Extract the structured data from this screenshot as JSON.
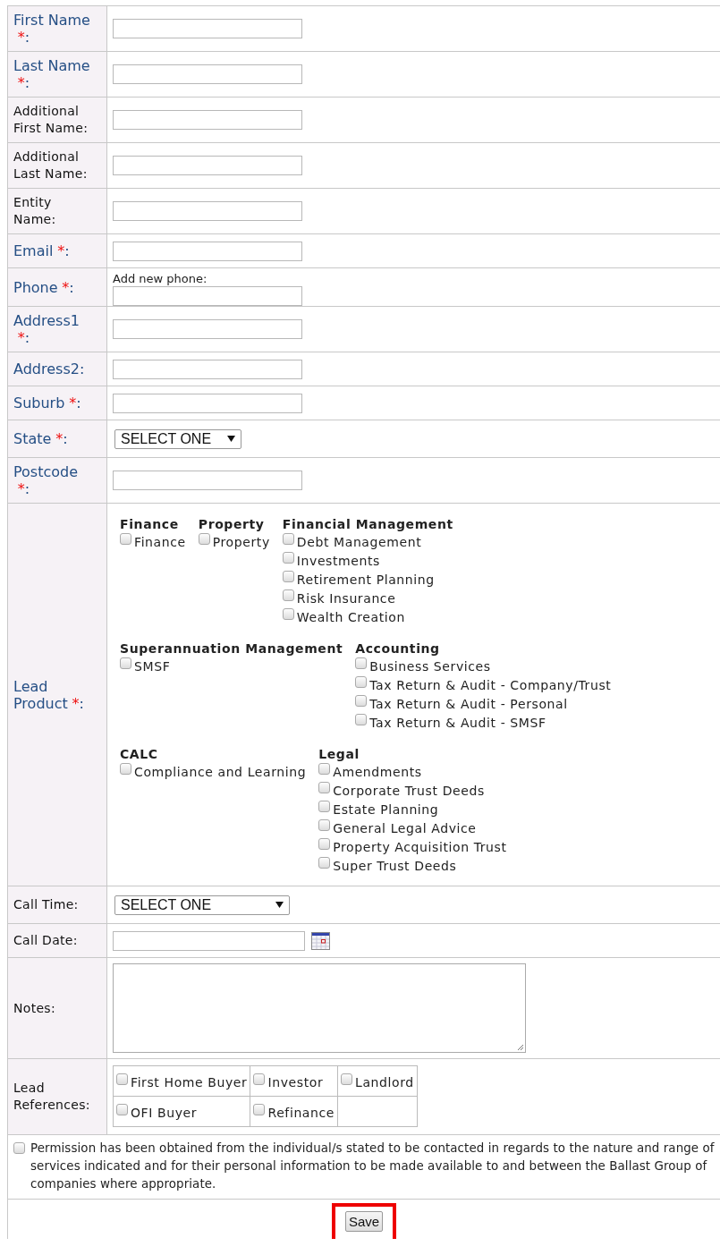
{
  "fields": [
    {
      "kind": "text",
      "label": "First Name",
      "accent": true,
      "required_mark": "*",
      "suffix": ":"
    },
    {
      "kind": "text",
      "label": "Last Name",
      "accent": true,
      "required_mark": "*",
      "suffix": ":"
    },
    {
      "kind": "text",
      "label": "Additional First Name",
      "accent": false,
      "suffix": ":"
    },
    {
      "kind": "text",
      "label": "Additional Last Name",
      "accent": false,
      "suffix": ":"
    },
    {
      "kind": "text",
      "label": "Entity Name",
      "accent": false,
      "suffix": ":"
    },
    {
      "kind": "text",
      "label": "Email",
      "accent": true,
      "required_mark": "*",
      "suffix": ":"
    },
    {
      "kind": "phone",
      "label": "Phone",
      "accent": true,
      "required_mark": "*",
      "suffix": ":",
      "hint": "Add new phone:"
    },
    {
      "kind": "text",
      "label": "Address1",
      "accent": true,
      "required_mark": "*",
      "suffix": ":"
    },
    {
      "kind": "text",
      "label": "Address2",
      "accent": true,
      "suffix": ":"
    },
    {
      "kind": "text",
      "label": "Suburb",
      "accent": true,
      "required_mark": "*",
      "suffix": ":"
    },
    {
      "kind": "select",
      "label": "State",
      "accent": true,
      "required_mark": "*",
      "suffix": ":",
      "value": "SELECT ONE"
    },
    {
      "kind": "text",
      "label": "Postcode",
      "accent": true,
      "required_mark": "*",
      "suffix": ":"
    },
    {
      "kind": "products",
      "label": "Lead Product",
      "accent": true,
      "required_mark": "*",
      "suffix": ":",
      "rows": [
        {
          "groups": [
            {
              "title": "Finance",
              "options": [
                {
                  "label": "Finance",
                  "checked": false
                }
              ]
            },
            {
              "title": "Property",
              "options": [
                {
                  "label": "Property",
                  "checked": false
                }
              ]
            },
            {
              "title": "Financial Management",
              "options": [
                {
                  "label": "Debt Management",
                  "checked": false
                },
                {
                  "label": "Investments",
                  "checked": false
                },
                {
                  "label": "Retirement Planning",
                  "checked": false
                },
                {
                  "label": "Risk Insurance",
                  "checked": false
                },
                {
                  "label": "Wealth Creation",
                  "checked": false
                }
              ]
            }
          ]
        },
        {
          "groups": [
            {
              "title": "Superannuation Management",
              "options": [
                {
                  "label": "SMSF",
                  "checked": false
                }
              ]
            },
            {
              "title": "Accounting",
              "options": [
                {
                  "label": "Business Services",
                  "checked": false
                },
                {
                  "label": "Tax Return & Audit - Company/Trust",
                  "checked": false
                },
                {
                  "label": "Tax Return & Audit - Personal",
                  "checked": false
                },
                {
                  "label": "Tax Return & Audit - SMSF",
                  "checked": false
                }
              ]
            }
          ]
        },
        {
          "groups": [
            {
              "title": "CALC",
              "options": [
                {
                  "label": "Compliance and Learning",
                  "checked": false
                }
              ]
            },
            {
              "title": "Legal",
              "options": [
                {
                  "label": "Amendments",
                  "checked": false
                },
                {
                  "label": "Corporate Trust Deeds",
                  "checked": false
                },
                {
                  "label": "Estate Planning",
                  "checked": false
                },
                {
                  "label": "General Legal Advice",
                  "checked": false
                },
                {
                  "label": "Property Acquisition Trust",
                  "checked": false
                },
                {
                  "label": "Super Trust Deeds",
                  "checked": false
                }
              ]
            }
          ]
        }
      ]
    },
    {
      "kind": "select",
      "label": "Call Time",
      "accent": false,
      "suffix": ":",
      "value": "SELECT ONE"
    },
    {
      "kind": "date",
      "label": "Call Date",
      "accent": false,
      "suffix": ":"
    },
    {
      "kind": "textarea",
      "label": "Notes",
      "accent": false,
      "suffix": ":"
    },
    {
      "kind": "references",
      "label": "Lead References",
      "accent": false,
      "suffix": ":",
      "options": [
        {
          "label": "First Home Buyer",
          "checked": false
        },
        {
          "label": "Investor",
          "checked": false
        },
        {
          "label": "Landlord",
          "checked": false
        },
        {
          "label": "OFI Buyer",
          "checked": false
        },
        {
          "label": "Refinance",
          "checked": false
        }
      ]
    }
  ],
  "permission": {
    "checked": false,
    "text": "Permission has been obtained from the individual/s stated to be contacted in regards to the nature and range of services indicated and for their personal information to be made available to and between the Ballast Group of companies where appropriate."
  },
  "save_button": {
    "label": "Save",
    "highlighted": true
  }
}
